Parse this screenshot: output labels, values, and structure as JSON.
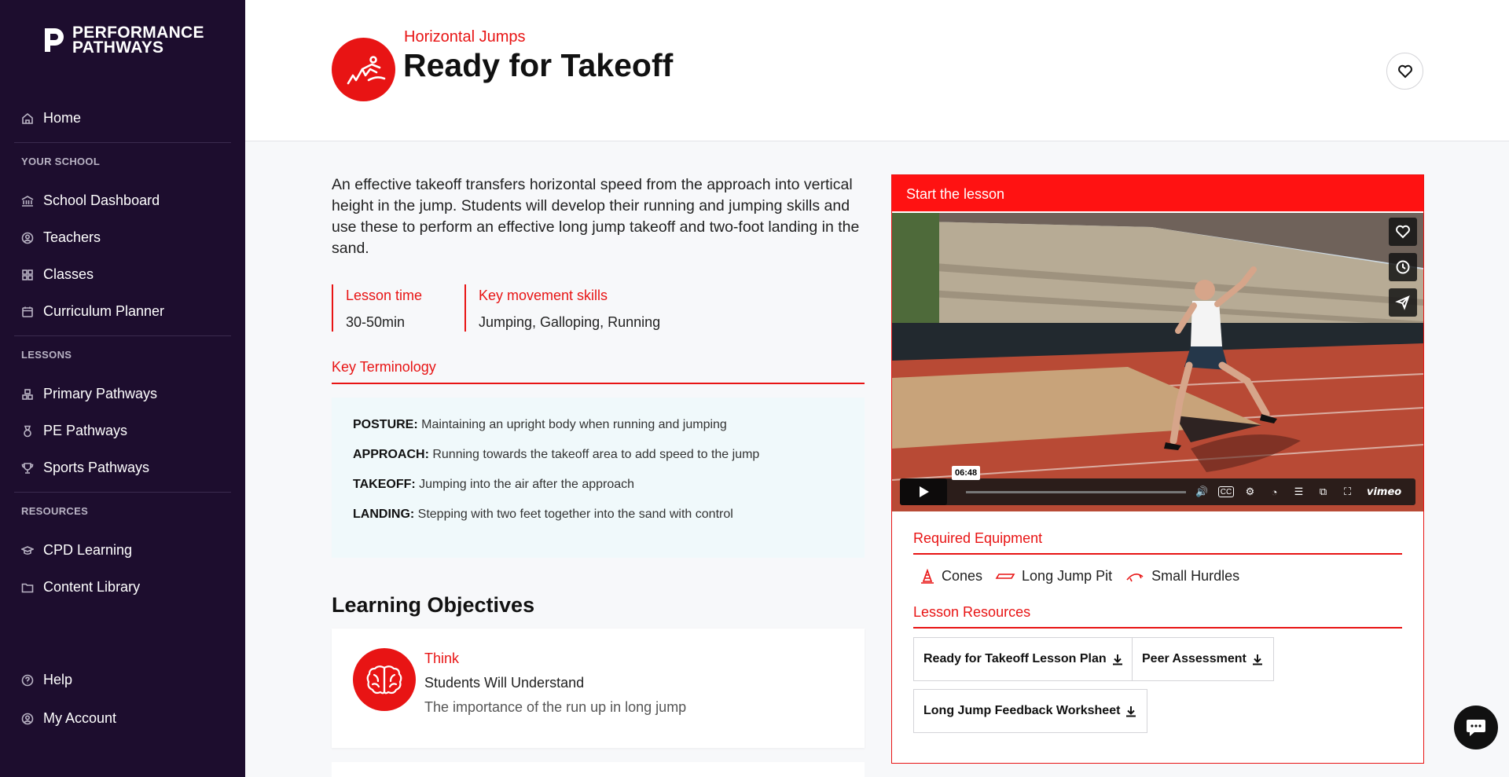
{
  "brand": {
    "line1": "PERFORMANCE",
    "line2": "PATHWAYS"
  },
  "sidebar": {
    "home": "Home",
    "section_school": "YOUR SCHOOL",
    "school_items": [
      "School Dashboard",
      "Teachers",
      "Classes",
      "Curriculum Planner"
    ],
    "section_lessons": "LESSONS",
    "lesson_items": [
      "Primary Pathways",
      "PE Pathways",
      "Sports Pathways"
    ],
    "section_resources": "RESOURCES",
    "resource_items": [
      "CPD Learning",
      "Content Library"
    ],
    "help": "Help",
    "account": "My Account"
  },
  "header": {
    "category": "Horizontal Jumps",
    "title": "Ready for Takeoff"
  },
  "intro": "An effective takeoff transfers horizontal speed from the approach into vertical height in the jump. Students will develop their running and jumping skills and use these to perform an effective long jump takeoff and two-foot landing in the sand.",
  "meta": {
    "time_label": "Lesson time",
    "time_value": "30-50min",
    "skills_label": "Key movement skills",
    "skills_value": "Jumping, Galloping, Running"
  },
  "terminology": {
    "title": "Key Terminology",
    "items": [
      {
        "term": "POSTURE:",
        "definition": " Maintaining an upright body when running and jumping"
      },
      {
        "term": "APPROACH:",
        "definition": " Running towards the takeoff area to add speed to the jump"
      },
      {
        "term": "TAKEOFF:",
        "definition": " Jumping into the air after the approach"
      },
      {
        "term": "LANDING:",
        "definition": " Stepping with two feet together into the sand with control"
      }
    ]
  },
  "objectives": {
    "title": "Learning Objectives",
    "card": {
      "kicker": "Think",
      "heading": "Students Will Understand",
      "text": "The importance of the run up in long jump"
    }
  },
  "lesson": {
    "header": "Start the lesson",
    "video": {
      "time": "06:48",
      "brand": "vimeo",
      "progress": 0.0
    },
    "equipment_title": "Required Equipment",
    "equipment": [
      "Cones",
      "Long Jump Pit",
      "Small Hurdles"
    ],
    "resources_title": "Lesson Resources",
    "resources": [
      "Ready for Takeoff Lesson Plan",
      "Peer Assessment",
      "Long Jump Feedback Worksheet"
    ]
  },
  "colors": {
    "accent": "#e81414",
    "sidebar": "#1d0d2e",
    "terminology_bg": "#f0f9fb"
  }
}
